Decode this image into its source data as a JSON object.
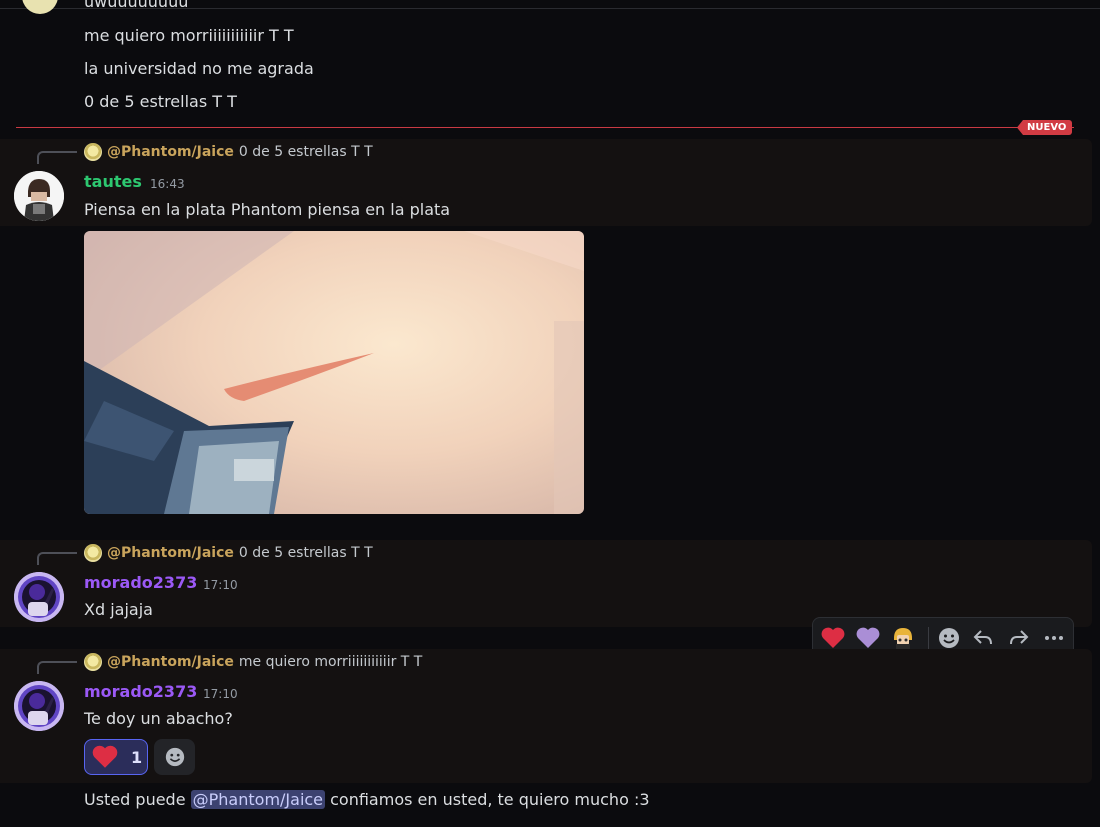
{
  "earlier": {
    "cut_line": "uwuuuuuuuu",
    "lines": [
      "me quiero morriiiiiiiiiiir T T",
      "la universidad no me agrada",
      "0 de 5 estrellas T T"
    ]
  },
  "divider": {
    "label": "NUEVO",
    "color": "#d13b43"
  },
  "messages": [
    {
      "reply": {
        "name": "@Phantom/Jaice",
        "text": "0 de 5 estrellas T T"
      },
      "author": "tautes",
      "author_color": "#2dc770",
      "time": "16:43",
      "text": "Piensa en la plata Phantom piensa en la plata",
      "has_image": true
    },
    {
      "reply": {
        "name": "@Phantom/Jaice",
        "text": "0 de 5 estrellas T T"
      },
      "author": "morado2373",
      "author_color": "#9b59f6",
      "time": "17:10",
      "text": "Xd jajaja"
    },
    {
      "reply": {
        "name": "@Phantom/Jaice",
        "text": "me quiero morriiiiiiiiiiir T T"
      },
      "author": "morado2373",
      "author_color": "#9b59f6",
      "time": "17:10",
      "text": "Te doy un abacho?",
      "reaction": {
        "emoji": "heart",
        "count": "1"
      }
    }
  ],
  "last_line": {
    "before": "Usted puede ",
    "mention": "@Phantom/Jaice",
    "after": " confiamos en usted, te quiero mucho :3"
  },
  "hover_bar": {
    "items": [
      "red-heart-icon",
      "purple-heart-icon",
      "custom-emoji-icon",
      "add-reaction-icon",
      "reply-icon",
      "forward-icon",
      "more-icon"
    ]
  }
}
